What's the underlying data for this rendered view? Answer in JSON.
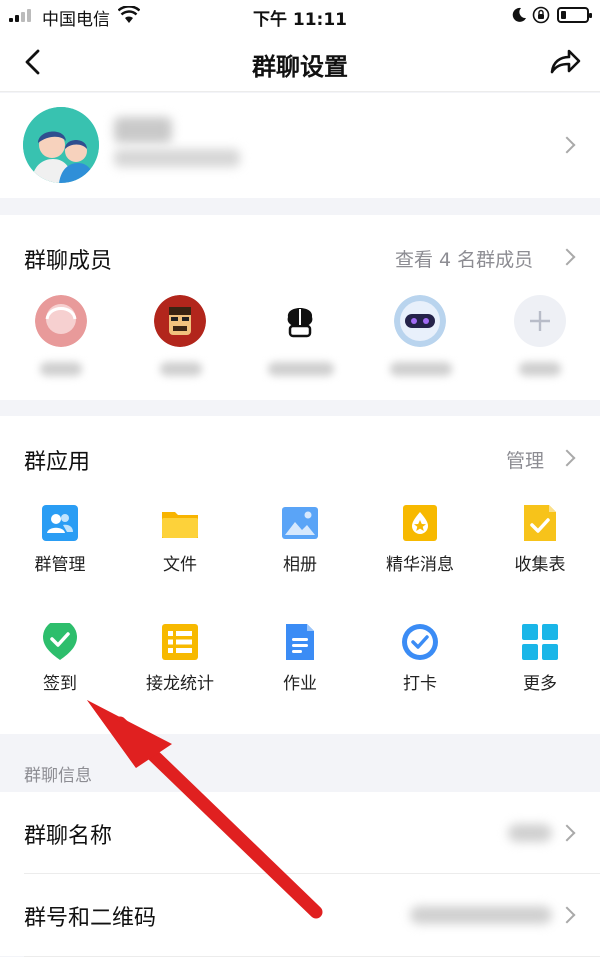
{
  "status_bar": {
    "carrier": "中国电信",
    "time": "下午 11:11"
  },
  "nav": {
    "title": "群聊设置"
  },
  "members": {
    "title": "群聊成员",
    "view_all": "查看 4 名群成员"
  },
  "apps": {
    "title": "群应用",
    "manage": "管理",
    "items": [
      {
        "label": "群管理",
        "icon": "group-manage-icon",
        "color": "#2a9df4"
      },
      {
        "label": "文件",
        "icon": "folder-icon",
        "color": "#fbc02d"
      },
      {
        "label": "相册",
        "icon": "photo-album-icon",
        "color": "#3b8cf5"
      },
      {
        "label": "精华消息",
        "icon": "highlight-message-icon",
        "color": "#f5b300"
      },
      {
        "label": "收集表",
        "icon": "collection-form-icon",
        "color": "#f7c31a"
      },
      {
        "label": "签到",
        "icon": "check-in-icon",
        "color": "#2dbe6c"
      },
      {
        "label": "接龙统计",
        "icon": "chain-stats-icon",
        "color": "#f5b300"
      },
      {
        "label": "作业",
        "icon": "homework-icon",
        "color": "#3b8cf5"
      },
      {
        "label": "打卡",
        "icon": "clock-in-icon",
        "color": "#3b8cf5"
      },
      {
        "label": "更多",
        "icon": "more-apps-icon",
        "color": "#1ab6e8"
      }
    ]
  },
  "info": {
    "section_title": "群聊信息",
    "group_name_label": "群聊名称",
    "group_number_label": "群号和二维码"
  },
  "colors": {
    "annotation_arrow": "#e02020",
    "chevron": "#a9a9a9",
    "secondary_text": "#8d8d93"
  }
}
